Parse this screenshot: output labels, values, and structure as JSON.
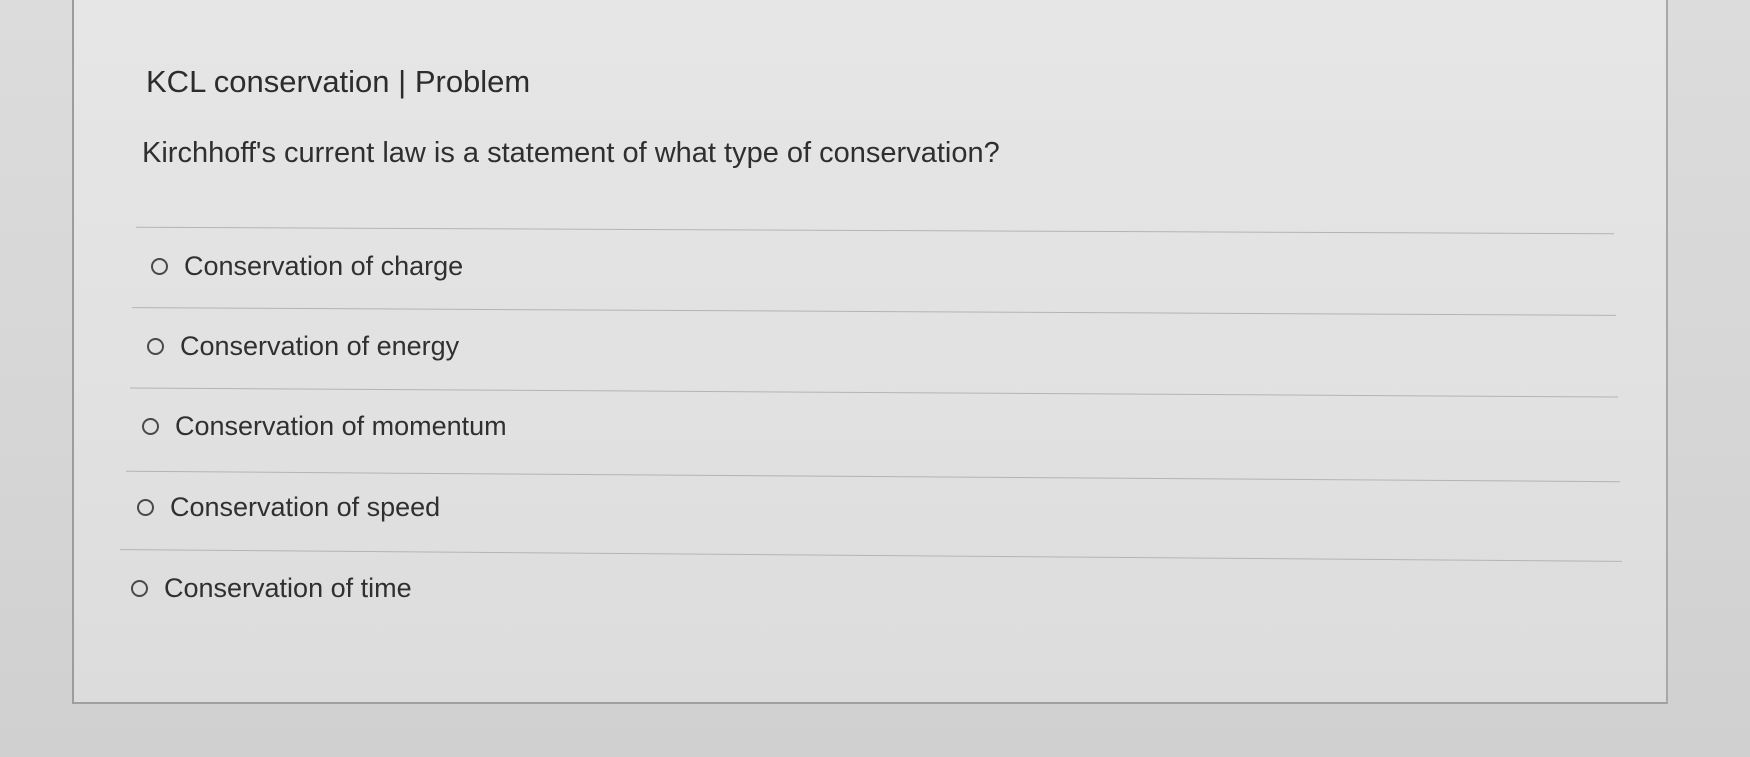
{
  "header": {
    "title": "KCL conservation | Problem"
  },
  "question": {
    "text": "Kirchhoff's current law is a statement of what type of conservation?"
  },
  "options": [
    {
      "label": "Conservation of charge",
      "selected": false
    },
    {
      "label": "Conservation of energy",
      "selected": false
    },
    {
      "label": "Conservation of momentum",
      "selected": false
    },
    {
      "label": "Conservation of speed",
      "selected": false
    },
    {
      "label": "Conservation of time",
      "selected": false
    }
  ]
}
